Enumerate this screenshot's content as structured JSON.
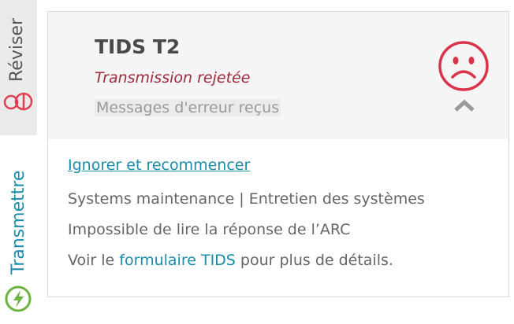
{
  "tabs": {
    "review": {
      "label": "Réviser",
      "icon": "review-circles-icon"
    },
    "transmit": {
      "label": "Transmettre",
      "icon": "lightning-icon"
    }
  },
  "card": {
    "title": "TIDS T2",
    "status": "Transmission rejetée",
    "subtitle": "Messages d'erreur reçus",
    "status_icon": "sad-face-icon",
    "collapse_icon": "chevron-up-icon",
    "reset_link": "Ignorer et recommencer",
    "messages": [
      "Systems maintenance | Entretien des systèmes",
      "Impossible de lire la réponse de l’ARC"
    ],
    "footer": {
      "prefix": "Voir le ",
      "link": "formulaire TIDS",
      "suffix": " pour plus de détails."
    }
  },
  "colors": {
    "accent": "#1a8cab",
    "error": "#d9344a",
    "status_text": "#9e2a3d",
    "transmit_green": "#6db33f"
  }
}
